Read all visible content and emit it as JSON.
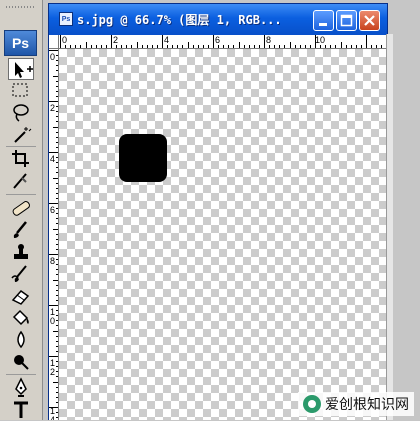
{
  "document": {
    "title": "s.jpg @ 66.7% (图层 1, RGB...",
    "icon_text": "Ps"
  },
  "app": {
    "logo_text": "Ps"
  },
  "window_buttons": [
    "minimize-icon",
    "maximize-icon",
    "close-icon"
  ],
  "tools": [
    "move-tool-icon",
    "marquee-tool-icon",
    "lasso-tool-icon",
    "magic-wand-tool-icon",
    "crop-tool-icon",
    "slice-tool-icon",
    "healing-brush-tool-icon",
    "brush-tool-icon",
    "clone-stamp-tool-icon",
    "history-brush-tool-icon",
    "eraser-tool-icon",
    "paint-bucket-tool-icon",
    "blur-tool-icon",
    "dodge-tool-icon",
    "pen-tool-icon",
    "type-tool-icon"
  ],
  "ruler": {
    "top_labels": [
      "0",
      "2",
      "4",
      "6",
      "8",
      "10"
    ],
    "left_labels": [
      "0",
      "2",
      "4",
      "6",
      "8",
      "1\n0",
      "1\n2",
      "1\n4"
    ]
  },
  "colors": {
    "titlebar": "#0b5fe0",
    "checker_light": "#ffffff",
    "checker_dark": "#cccccc",
    "shape": "#000000"
  },
  "watermark": {
    "text": "爱创根知识网"
  }
}
